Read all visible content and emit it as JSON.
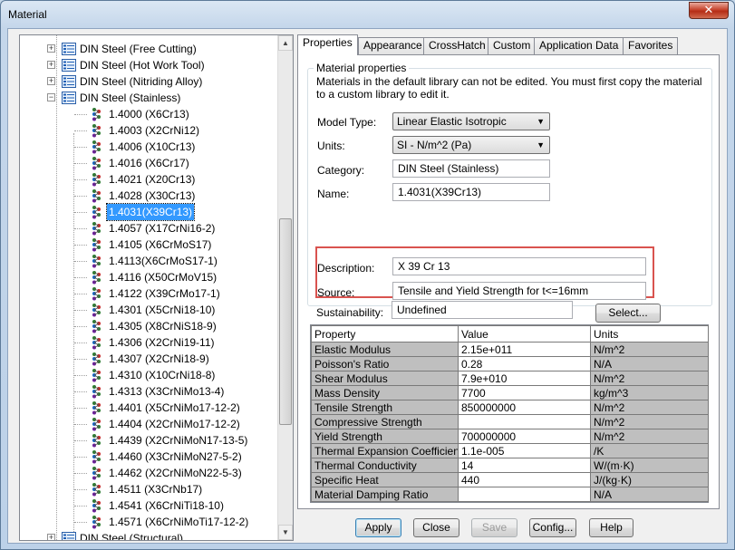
{
  "window": {
    "title": "Material",
    "close_glyph": "✕"
  },
  "tree": {
    "categories_top": [
      {
        "label": "DIN Steel (Free Cutting)",
        "expander": "+"
      },
      {
        "label": "DIN Steel (Hot Work Tool)",
        "expander": "+"
      },
      {
        "label": "DIN Steel (Nitriding Alloy)",
        "expander": "+"
      },
      {
        "label": "DIN Steel (Stainless)",
        "expander": "−"
      }
    ],
    "materials": [
      "1.4000 (X6Cr13)",
      "1.4003 (X2CrNi12)",
      "1.4006 (X10Cr13)",
      "1.4016 (X6Cr17)",
      "1.4021 (X20Cr13)",
      "1.4028 (X30Cr13)",
      "1.4031(X39Cr13)",
      "1.4057 (X17CrNi16-2)",
      "1.4105 (X6CrMoS17)",
      "1.4113(X6CrMoS17-1)",
      "1.4116 (X50CrMoV15)",
      "1.4122 (X39CrMo17-1)",
      "1.4301 (X5CrNi18-10)",
      "1.4305 (X8CrNiS18-9)",
      "1.4306 (X2CrNi19-11)",
      "1.4307 (X2CrNi18-9)",
      "1.4310 (X10CrNi18-8)",
      "1.4313 (X3CrNiMo13-4)",
      "1.4401 (X5CrNiMo17-12-2)",
      "1.4404 (X2CrNiMo17-12-2)",
      "1.4439 (X2CrNiMoN17-13-5)",
      "1.4460 (X3CrNiMoN27-5-2)",
      "1.4462 (X2CrNiMoN22-5-3)",
      "1.4511 (X3CrNb17)",
      "1.4541 (X6CrNiTi18-10)",
      "1.4571 (X6CrNiMoTi17-12-2)"
    ],
    "selected_material": "1.4031(X39Cr13)",
    "category_bottom": {
      "label": "DIN Steel (Structural)",
      "expander": "+"
    }
  },
  "tabs": [
    {
      "label": "Properties",
      "active": true
    },
    {
      "label": "Appearance",
      "active": false
    },
    {
      "label": "CrossHatch",
      "active": false
    },
    {
      "label": "Custom",
      "active": false
    },
    {
      "label": "Application Data",
      "active": false
    },
    {
      "label": "Favorites",
      "active": false
    }
  ],
  "material_properties": {
    "group_title": "Material properties",
    "note": "Materials in the default library can not be edited. You must first copy the material to a custom library to edit it.",
    "model_type_label": "Model Type:",
    "model_type_value": "Linear Elastic Isotropic",
    "units_label": "Units:",
    "units_value": "SI - N/m^2 (Pa)",
    "category_label": "Category:",
    "category_value": "DIN Steel (Stainless)",
    "name_label": "Name:",
    "name_value": "1.4031(X39Cr13)",
    "description_label": "Description:",
    "description_value": "X 39 Cr 13",
    "source_label": "Source:",
    "source_value": "Tensile and Yield Strength for t<=16mm",
    "sustainability_label": "Sustainability:",
    "sustainability_value": "Undefined",
    "select_button": "Select..."
  },
  "property_table": {
    "headers": [
      "Property",
      "Value",
      "Units"
    ],
    "rows": [
      [
        "Elastic Modulus",
        "2.15e+011",
        "N/m^2"
      ],
      [
        "Poisson's Ratio",
        "0.28",
        "N/A"
      ],
      [
        "Shear Modulus",
        "7.9e+010",
        "N/m^2"
      ],
      [
        "Mass Density",
        "7700",
        "kg/m^3"
      ],
      [
        "Tensile Strength",
        "850000000",
        "N/m^2"
      ],
      [
        "Compressive Strength",
        "",
        "N/m^2"
      ],
      [
        "Yield Strength",
        "700000000",
        "N/m^2"
      ],
      [
        "Thermal Expansion Coefficient",
        "1.1e-005",
        "/K"
      ],
      [
        "Thermal Conductivity",
        "14",
        "W/(m·K)"
      ],
      [
        "Specific Heat",
        "440",
        "J/(kg·K)"
      ],
      [
        "Material Damping Ratio",
        "",
        "N/A"
      ]
    ]
  },
  "buttons": {
    "apply": "Apply",
    "close": "Close",
    "save": "Save",
    "config": "Config...",
    "help": "Help"
  },
  "colors": {
    "selection": "#3399ff",
    "highlight_box": "#d9534f",
    "window_frame": "#bcd1e8"
  }
}
